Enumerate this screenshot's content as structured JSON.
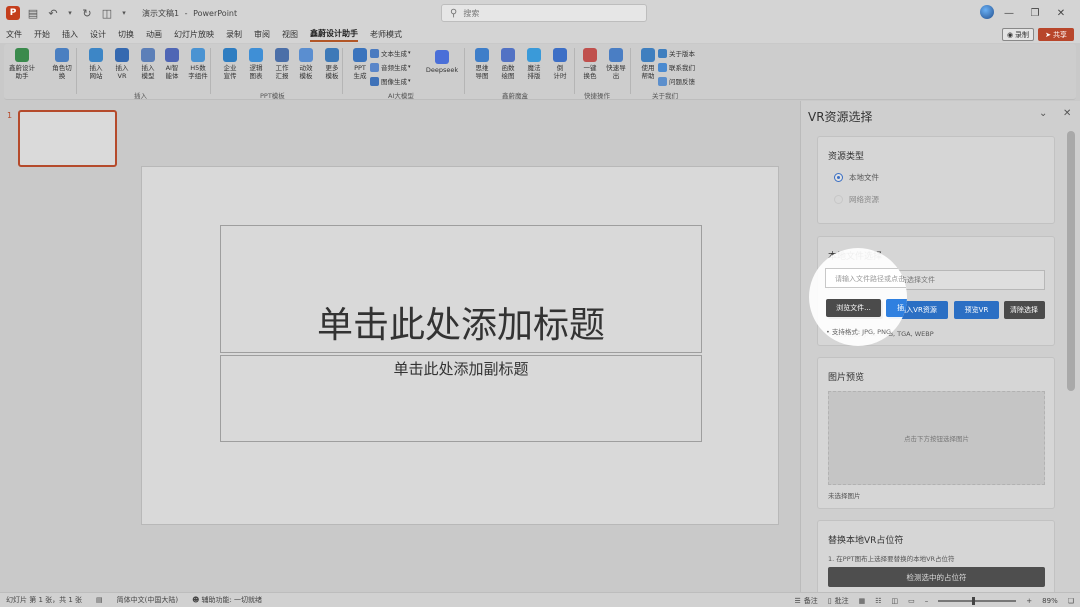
{
  "app": {
    "document_title": "演示文稿1",
    "app_name": "PowerPoint",
    "title_sep": "-",
    "search_placeholder": "搜索"
  },
  "menu": [
    "文件",
    "开始",
    "插入",
    "设计",
    "切换",
    "动画",
    "幻灯片放映",
    "录制",
    "审阅",
    "视图",
    "鑫蔚设计助手",
    "老师模式"
  ],
  "menu_active_index": 10,
  "topright": {
    "record_label": "录制",
    "share_label": "共享"
  },
  "ribbon": {
    "items": [
      {
        "name": "design-assistant",
        "label1": "鑫蔚设计",
        "label2": "助手",
        "color": "#3a8a4c"
      },
      {
        "name": "role-switch",
        "label1": "角色切",
        "label2": "换",
        "color": "#4a7fc1"
      },
      {
        "name": "insert-website",
        "label1": "插入",
        "label2": "网站",
        "color": "#3d86c6"
      },
      {
        "name": "insert-vr",
        "label1": "插入",
        "label2": "VR",
        "color": "#3569b0"
      },
      {
        "name": "insert-model",
        "label1": "插入",
        "label2": "模型",
        "color": "#5c7fb8"
      },
      {
        "name": "ai-digital-human",
        "label1": "AI智",
        "label2": "能体",
        "color": "#4f66b5"
      },
      {
        "name": "h5-components",
        "label1": "H5数",
        "label2": "字组件",
        "color": "#4a93d2"
      },
      {
        "name": "corporate-promo",
        "label1": "企业",
        "label2": "宣传",
        "color": "#2e7dc1"
      },
      {
        "name": "logic-diagram",
        "label1": "逻辑",
        "label2": "图表",
        "color": "#3f8fd6"
      },
      {
        "name": "work-report",
        "label1": "工作",
        "label2": "汇报",
        "color": "#4b6fa8"
      },
      {
        "name": "animation-template",
        "label1": "动效",
        "label2": "模板",
        "color": "#5a8ed0"
      },
      {
        "name": "more-templates",
        "label1": "更多",
        "label2": "模板",
        "color": "#3d79b8"
      },
      {
        "name": "ppt-generate",
        "label1": "PPT",
        "label2": "生成",
        "color": "#3b74bd"
      },
      {
        "name": "deepseek",
        "label1": "Deepseek",
        "label2": "",
        "color": "#4a6fd8"
      },
      {
        "name": "mind-map-navigator",
        "label1": "思维",
        "label2": "导图",
        "color": "#3e7ec9"
      },
      {
        "name": "function-plot",
        "label1": "函数",
        "label2": "绘图",
        "color": "#5272c4"
      },
      {
        "name": "magic-layout",
        "label1": "魔法",
        "label2": "排版",
        "color": "#3a9ad9"
      },
      {
        "name": "countdown-timer",
        "label1": "倒",
        "label2": "计时",
        "color": "#3d6fc6"
      },
      {
        "name": "one-click-color",
        "label1": "一键",
        "label2": "换色",
        "color": "#c0504d"
      },
      {
        "name": "quick-export",
        "label1": "快速导",
        "label2": "出",
        "color": "#4a7ec4"
      },
      {
        "name": "help",
        "label1": "使用",
        "label2": "帮助",
        "color": "#3f7fbf"
      }
    ],
    "ai_small": [
      "文本生成",
      "音频生成",
      "图像生成"
    ],
    "about_small": [
      "关于版本",
      "联系我们",
      "问题反馈"
    ],
    "groups": [
      "插入",
      "PPT模板",
      "AI大模型",
      "鑫蔚魔盒",
      "快捷操作",
      "关于我们"
    ]
  },
  "thumbnail": {
    "number": "1"
  },
  "slide": {
    "title_placeholder": "单击此处添加标题",
    "subtitle_placeholder": "单击此处添加副标题"
  },
  "pane": {
    "title": "VR资源选择",
    "resource_type": {
      "heading": "资源类型",
      "options": [
        "本地文件",
        "网络资源"
      ],
      "selected": "本地文件"
    },
    "local_file": {
      "heading": "本地文件选择",
      "input_placeholder": "请输入文件路径或点击选择文件",
      "buttons": [
        "浏览文件...",
        "插入VR资源",
        "预览VR",
        "清除选择"
      ],
      "formats": "• 支持格式: JPG, PNG, TGA, WEBP"
    },
    "image_preview": {
      "heading": "图片预览",
      "placeholder": "点击下方按钮选择图片",
      "status": "未选择图片"
    },
    "replace": {
      "heading": "替换本地VR占位符",
      "step1": "1. 在PPT图布上选择要替换的本地VR占位符",
      "detect_button": "检测选中的占位符"
    }
  },
  "status": {
    "slide_info": "幻灯片 第 1 张，共 1 张",
    "language": "简体中文(中国大陆)",
    "accessibility": "辅助功能: 一切就绪",
    "notes": "备注",
    "comments": "批注",
    "zoom": "89%"
  },
  "colors": {
    "accent": "#b54a2b",
    "blue_button": "#2b6fc4",
    "dark_button": "#4b4b4b"
  }
}
